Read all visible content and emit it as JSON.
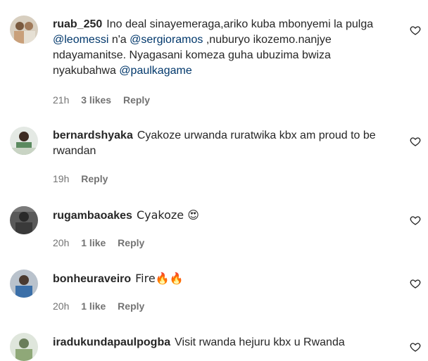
{
  "comments": [
    {
      "username": "ruab_250",
      "text_parts": [
        "Ino deal sinayemeraga,ariko kuba mbonyemi la pulga ",
        "@leomessi",
        " n'a ",
        "@sergioramos",
        " ,nuburyo ikozemo.nanjye ndayamanitse. Nyagasani komeza guha ubuzima bwiza nyakubahwa ",
        "@paulkagame"
      ],
      "time": "21h",
      "likes": "3 likes",
      "reply": "Reply"
    },
    {
      "username": "bernardshyaka",
      "text": "Cyakoze urwanda ruratwika kbx am proud to be rwandan",
      "time": "19h",
      "reply": "Reply"
    },
    {
      "username": "rugambaoakes",
      "text": "Cyakoze 😍",
      "time": "20h",
      "likes": "1 like",
      "reply": "Reply"
    },
    {
      "username": "bonheuraveiro",
      "text": "Fire🔥🔥",
      "time": "20h",
      "likes": "1 like",
      "reply": "Reply"
    },
    {
      "username": "iradukundapaulpogba",
      "text": "Visit rwanda hejuru kbx u Rwanda"
    }
  ],
  "icons": {
    "like": "heart-outline-icon"
  },
  "colors": {
    "text": "#262626",
    "meta": "#737373",
    "mention": "#00376b"
  }
}
